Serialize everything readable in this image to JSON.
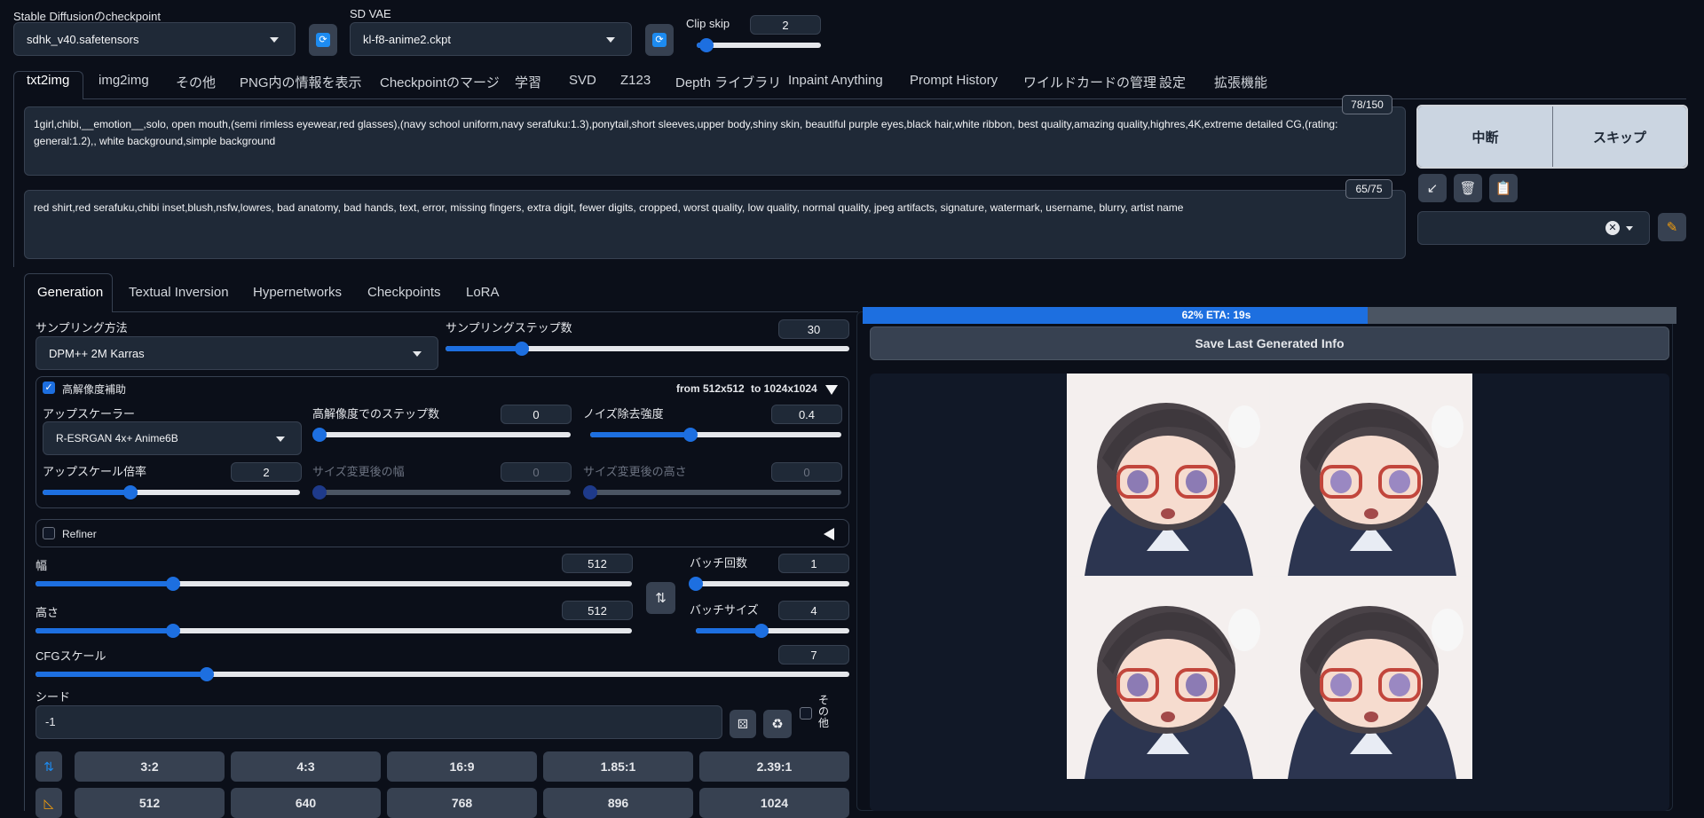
{
  "header": {
    "checkpoint_label": "Stable Diffusionのcheckpoint",
    "checkpoint_value": "sdhk_v40.safetensors",
    "vae_label": "SD VAE",
    "vae_value": "kl-f8-anime2.ckpt",
    "clip_skip_label": "Clip skip",
    "clip_skip_value": "2",
    "clip_skip_level": 0.08
  },
  "tabs": [
    "txt2img",
    "img2img",
    "その他",
    "PNG内の情報を表示",
    "Checkpointのマージ",
    "学習",
    "SVD",
    "Z123",
    "Depth ライブラリ",
    "Inpaint Anything",
    "Prompt History",
    "ワイルドカードの管理",
    "設定",
    "拡張機能"
  ],
  "prompt": {
    "positive": "1girl,chibi,__emotion__,solo, open mouth,(semi rimless eyewear,red glasses),(navy school uniform,navy serafuku:1.3),ponytail,short sleeves,upper body,shiny skin, beautiful purple eyes,black hair,white ribbon, best quality,amazing quality,highres,4K,extreme detailed CG,(rating: general:1.2),, white background,simple background",
    "positive_counter": "78/150",
    "negative": "red shirt,red serafuku,chibi inset,blush,nsfw,lowres, bad anatomy, bad hands, text, error, missing fingers, extra digit, fewer digits, cropped, worst quality, low quality, normal quality, jpeg artifacts, signature, watermark, username, blurry, artist name",
    "negative_counter": "65/75"
  },
  "actions": {
    "interrupt": "中断",
    "skip": "スキップ"
  },
  "subtabs": [
    "Generation",
    "Textual Inversion",
    "Hypernetworks",
    "Checkpoints",
    "LoRA"
  ],
  "generation": {
    "sampler_label": "サンプリング方法",
    "sampler_value": "DPM++ 2M Karras",
    "steps_label": "サンプリングステップ数",
    "steps_value": "30",
    "steps_level": 0.19,
    "hires": {
      "label": "高解像度補助",
      "summary_from": "from 512x512",
      "summary_to": "to 1024x1024",
      "upscaler_label": "アップスケーラー",
      "upscaler_value": "R-ESRGAN 4x+ Anime6B",
      "hires_steps_label": "高解像度でのステップ数",
      "hires_steps_value": "0",
      "hires_steps_level": 0.0,
      "denoise_label": "ノイズ除去強度",
      "denoise_value": "0.4",
      "denoise_level": 0.4,
      "scale_label": "アップスケール倍率",
      "scale_value": "2",
      "scale_level": 0.34,
      "width_label": "サイズ変更後の幅",
      "width_value": "0",
      "height_label": "サイズ変更後の高さ",
      "height_value": "0"
    },
    "refiner_label": "Refiner",
    "width_label": "幅",
    "width_value": "512",
    "width_level": 0.23,
    "height_label": "高さ",
    "height_value": "512",
    "height_level": 0.23,
    "batch_count_label": "バッチ回数",
    "batch_count_value": "1",
    "batch_count_level": 0.0,
    "batch_size_label": "バッチサイズ",
    "batch_size_value": "4",
    "batch_size_level": 0.43,
    "cfg_label": "CFGスケール",
    "cfg_value": "7",
    "cfg_level": 0.21,
    "seed_label": "シード",
    "seed_value": "-1",
    "extra_label": "その他",
    "ratios": [
      "3:2",
      "4:3",
      "16:9",
      "1.85:1",
      "2.39:1"
    ],
    "sizes": [
      "512",
      "640",
      "768",
      "896",
      "1024"
    ]
  },
  "output": {
    "progress_text": "62% ETA: 19s",
    "progress_level": 0.62,
    "save_label": "Save Last Generated Info"
  }
}
